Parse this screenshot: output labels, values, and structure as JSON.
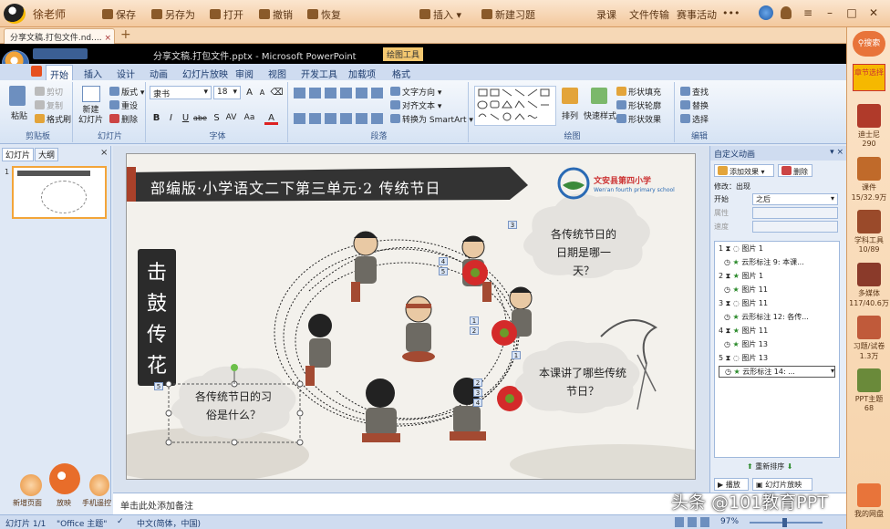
{
  "topbar": {
    "user": "徐老师",
    "menu": [
      "保存",
      "另存为",
      "打开",
      "撤销",
      "恢复",
      "插入",
      "新建习题",
      "录课",
      "文件传输",
      "赛事活动"
    ]
  },
  "tabs": {
    "file_tab": "分享文稿.打包文件.nd....",
    "close": "×",
    "add": "+"
  },
  "title": {
    "text": "分享文稿.打包文件.pptx - Microsoft PowerPoint",
    "tool": "绘图工具"
  },
  "ribbon_tabs": [
    "开始",
    "插入",
    "设计",
    "动画",
    "幻灯片放映",
    "审阅",
    "视图",
    "开发工具",
    "加载项",
    "格式"
  ],
  "ribbon": {
    "clipboard": {
      "paste": "粘贴",
      "cut": "剪切",
      "copy": "复制",
      "format_painter": "格式刷",
      "label": "剪贴板"
    },
    "slides": {
      "new": "新建\n幻灯片",
      "layout": "版式",
      "reset": "重设",
      "delete": "删除",
      "label": "幻灯片"
    },
    "font": {
      "name": "隶书",
      "size": "18",
      "label": "字体",
      "buttons": [
        "B",
        "I",
        "U",
        "abe",
        "S",
        "AV",
        "Aa",
        "A"
      ]
    },
    "paragraph": {
      "text_dir": "文字方向",
      "align_text": "对齐文本",
      "smartart": "转换为 SmartArt",
      "label": "段落"
    },
    "drawing": {
      "arrange": "排列",
      "quick_styles": "快速样式",
      "fill": "形状填充",
      "outline": "形状轮廓",
      "effects": "形状效果",
      "label": "绘图"
    },
    "editing": {
      "find": "查找",
      "replace": "替换",
      "select": "选择",
      "label": "编辑"
    }
  },
  "left_pane": {
    "tab_slides": "幻灯片",
    "tab_outline": "大纲",
    "close": "×",
    "thumb_num": "1"
  },
  "bottom_left": {
    "new_page": "新增页面",
    "play": "放映",
    "phone": "手机遥控"
  },
  "slide": {
    "banner": "部编版·小学语文二下第三单元·2 传统节日",
    "school_cn": "文安县第四小学",
    "school_en": "Wen'an fourth primary school",
    "vertical_title": [
      "击",
      "鼓",
      "传",
      "花"
    ],
    "bubble1": "各传统节日的日期是哪一天？",
    "bubble2": "本课讲了哪些传统节日？",
    "bubble3": "各传统节日的习俗是什么？",
    "tags": [
      {
        "t": "3"
      },
      {
        "t": "4"
      },
      {
        "t": "5"
      },
      {
        "t": "1"
      },
      {
        "t": "2"
      },
      {
        "t": "1"
      },
      {
        "t": "2"
      },
      {
        "t": "3"
      },
      {
        "t": "4"
      },
      {
        "t": "5"
      }
    ]
  },
  "right_pane": {
    "title": "自定义动画",
    "add_effect": "添加效果",
    "remove": "删除",
    "modify": "修改：出现",
    "start_label": "开始",
    "start_value": "之后",
    "prop_label": "属性",
    "speed_label": "速度",
    "items": [
      {
        "n": "1",
        "name": "图片 1",
        "sub": false
      },
      {
        "n": "",
        "name": "云形标注 9: 本课...",
        "sub": true
      },
      {
        "n": "2",
        "name": "图片 1",
        "sub": false
      },
      {
        "n": "",
        "name": "图片 11",
        "sub": true
      },
      {
        "n": "3",
        "name": "图片 11",
        "sub": false
      },
      {
        "n": "",
        "name": "云形标注 12: 各传...",
        "sub": true
      },
      {
        "n": "4",
        "name": "图片 11",
        "sub": false
      },
      {
        "n": "",
        "name": "图片 13",
        "sub": true
      },
      {
        "n": "5",
        "name": "图片 13",
        "sub": false
      },
      {
        "n": "",
        "name": "云形标注 14: ...",
        "sub": true
      }
    ],
    "reorder": "重新排序",
    "play": "播放",
    "slideshow": "幻灯片放映"
  },
  "notes": {
    "placeholder": "单击此处添加备注"
  },
  "status": {
    "slide": "幻灯片 1/1",
    "theme": "\"Office 主题\"",
    "lang": "中文(简体，中国)",
    "zoom": "97%"
  },
  "sidebar": {
    "search": "搜索",
    "lesson_select": "章节选择",
    "items": [
      {
        "label": "迪士尼",
        "count": "290"
      },
      {
        "label": "课件",
        "count": "15/32.9万"
      },
      {
        "label": "学科工具",
        "count": "10/89"
      },
      {
        "label": "多媒体",
        "count": "117/40.6万"
      },
      {
        "label": "习题/试卷",
        "count": "1.3万"
      },
      {
        "label": "PPT主题",
        "count": "68"
      }
    ],
    "network": "我的网盘"
  },
  "watermark": "头条 @101教育PPT",
  "colors": {
    "accent": "#f3a53a",
    "ribbon": "#d6e3f4",
    "banner": "#333333"
  }
}
